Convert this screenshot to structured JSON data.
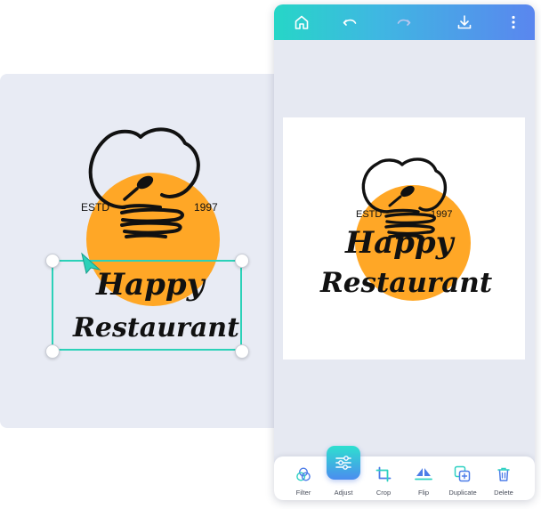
{
  "colors": {
    "accent_teal": "#2bd1b8",
    "orange_circle": "#ffa726",
    "canvas_bg": "#e8ebf4"
  },
  "logo": {
    "estd": "ESTD",
    "year": "1997",
    "line1": "Happy",
    "line2": "Restaurant"
  },
  "topbar": {
    "icons": [
      "home-icon",
      "undo-icon",
      "redo-icon",
      "download-icon",
      "more-vertical-icon"
    ]
  },
  "toolbar": {
    "filter": "Filter",
    "adjust": "Adjust",
    "crop": "Crop",
    "flip": "Flip",
    "duplicate": "Duplicate",
    "delete": "Delete"
  }
}
